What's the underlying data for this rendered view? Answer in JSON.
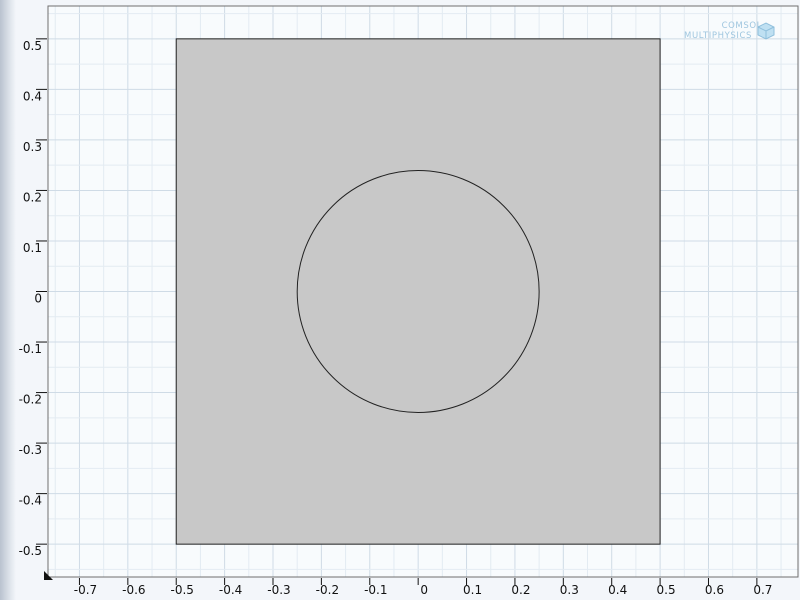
{
  "view": {
    "x_range": [
      -0.765,
      0.785
    ],
    "y_range": [
      -0.565,
      0.565
    ],
    "grid": true,
    "grid_step": 0.05,
    "major_step": 0.1
  },
  "axes": {
    "x_ticks": [
      -0.7,
      -0.6,
      -0.5,
      -0.4,
      -0.3,
      -0.2,
      -0.1,
      0,
      0.1,
      0.2,
      0.3,
      0.4,
      0.5,
      0.6,
      0.7
    ],
    "y_ticks": [
      0.5,
      0.4,
      0.3,
      0.2,
      0.1,
      0,
      -0.1,
      -0.2,
      -0.3,
      -0.4,
      -0.5
    ]
  },
  "geometry": {
    "square": {
      "x_min": -0.5,
      "x_max": 0.5,
      "y_min": -0.5,
      "y_max": 0.5,
      "fill": "#c8c8c8"
    },
    "circle": {
      "cx": 0,
      "cy": 0,
      "r": 0.25
    }
  },
  "colors": {
    "canvas_bg": "#f8fbfd",
    "grid_major": "#cfdbe6",
    "grid_minor": "#e3ebf2",
    "outline": "#222222",
    "frame": "#6f6f6f"
  },
  "logo": {
    "line1": "COMSOL",
    "line2": "MULTIPHYSICS",
    "icon": "comsol-cube-icon",
    "color": "#9fc6df"
  }
}
